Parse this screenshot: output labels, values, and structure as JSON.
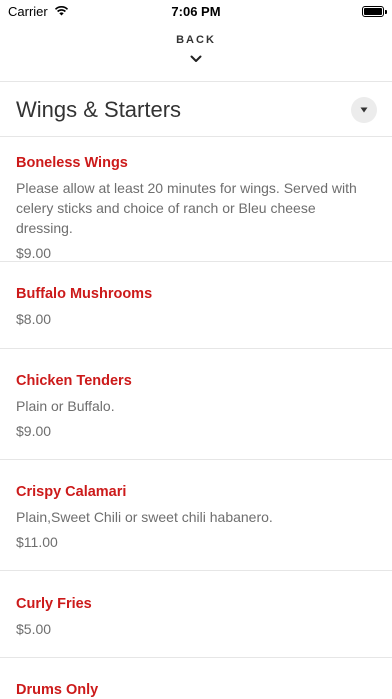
{
  "status_bar": {
    "carrier": "Carrier",
    "time": "7:06 PM"
  },
  "nav": {
    "back_label": "BACK"
  },
  "section": {
    "title": "Wings & Starters"
  },
  "items": [
    {
      "name": "Boneless Wings",
      "description": "Please allow at least 20 minutes for wings. Served with celery sticks and choice of ranch or Bleu cheese dressing.",
      "price": "$9.00"
    },
    {
      "name": "Buffalo Mushrooms",
      "description": "",
      "price": "$8.00"
    },
    {
      "name": "Chicken Tenders",
      "description": "Plain or Buffalo.",
      "price": "$9.00"
    },
    {
      "name": "Crispy Calamari",
      "description": "Plain,Sweet Chili or sweet chili habanero.",
      "price": "$11.00"
    },
    {
      "name": "Curly Fries",
      "description": "",
      "price": "$5.00"
    },
    {
      "name": "Drums Only",
      "description": "",
      "price": ""
    }
  ],
  "colors": {
    "item_name": "#cc1a1a",
    "secondary_text": "#6e6e6e",
    "divider": "#e6e6e6"
  }
}
